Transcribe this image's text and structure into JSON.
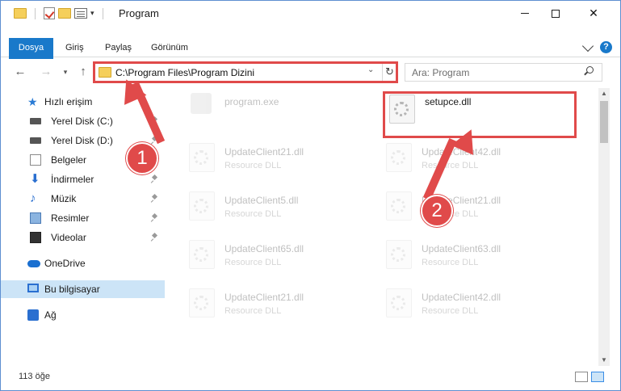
{
  "window": {
    "title": "Program",
    "quick_access_toolbar": [
      "folder-icon",
      "properties-check-icon",
      "new-folder-icon",
      "customize-icon"
    ]
  },
  "ribbon": {
    "tabs": [
      {
        "label": "Dosya",
        "active": true
      },
      {
        "label": "Giriş"
      },
      {
        "label": "Paylaş"
      },
      {
        "label": "Görünüm"
      }
    ]
  },
  "address_bar": {
    "path": "C:\\Program Files\\Program Dizini"
  },
  "search": {
    "placeholder": "Ara: Program"
  },
  "nav_pane": {
    "quick_access_label": "Hızlı erişim",
    "quick_items": [
      {
        "label": "Yerel Disk (C:)",
        "icon": "drive-icon",
        "pinned": true
      },
      {
        "label": "Yerel Disk (D:)",
        "icon": "drive-icon",
        "pinned": true
      },
      {
        "label": "Belgeler",
        "icon": "documents-icon",
        "pinned": true
      },
      {
        "label": "İndirmeler",
        "icon": "download-icon",
        "pinned": true
      },
      {
        "label": "Müzik",
        "icon": "music-icon",
        "pinned": true
      },
      {
        "label": "Resimler",
        "icon": "pictures-icon",
        "pinned": true
      },
      {
        "label": "Videolar",
        "icon": "video-icon",
        "pinned": true
      }
    ],
    "onedrive_label": "OneDrive",
    "thispc_label": "Bu bilgisayar",
    "network_label": "Ağ"
  },
  "files": [
    {
      "name": "program.exe",
      "type": ""
    },
    {
      "name": "setupce.dll",
      "type": "",
      "highlighted": true
    },
    {
      "name": "UpdateClient21.dll",
      "type": "Resource DLL"
    },
    {
      "name": "UpdateClient42.dll",
      "type": "Resource DLL"
    },
    {
      "name": "UpdateClient5.dll",
      "type": "Resource DLL"
    },
    {
      "name": "UpdateClient21.dll",
      "type": "Resource DLL"
    },
    {
      "name": "UpdateClient65.dll",
      "type": "Resource DLL"
    },
    {
      "name": "UpdateClient63.dll",
      "type": "Resource DLL"
    },
    {
      "name": "UpdateClient21.dll",
      "type": "Resource DLL"
    },
    {
      "name": "UpdateClient42.dll",
      "type": "Resource DLL"
    }
  ],
  "callouts": [
    "1",
    "2"
  ],
  "status": {
    "item_count": "113 öğe"
  },
  "colors": {
    "accent": "#1979ca",
    "annotation_red": "#e04a4a",
    "selection": "#cce4f7"
  }
}
